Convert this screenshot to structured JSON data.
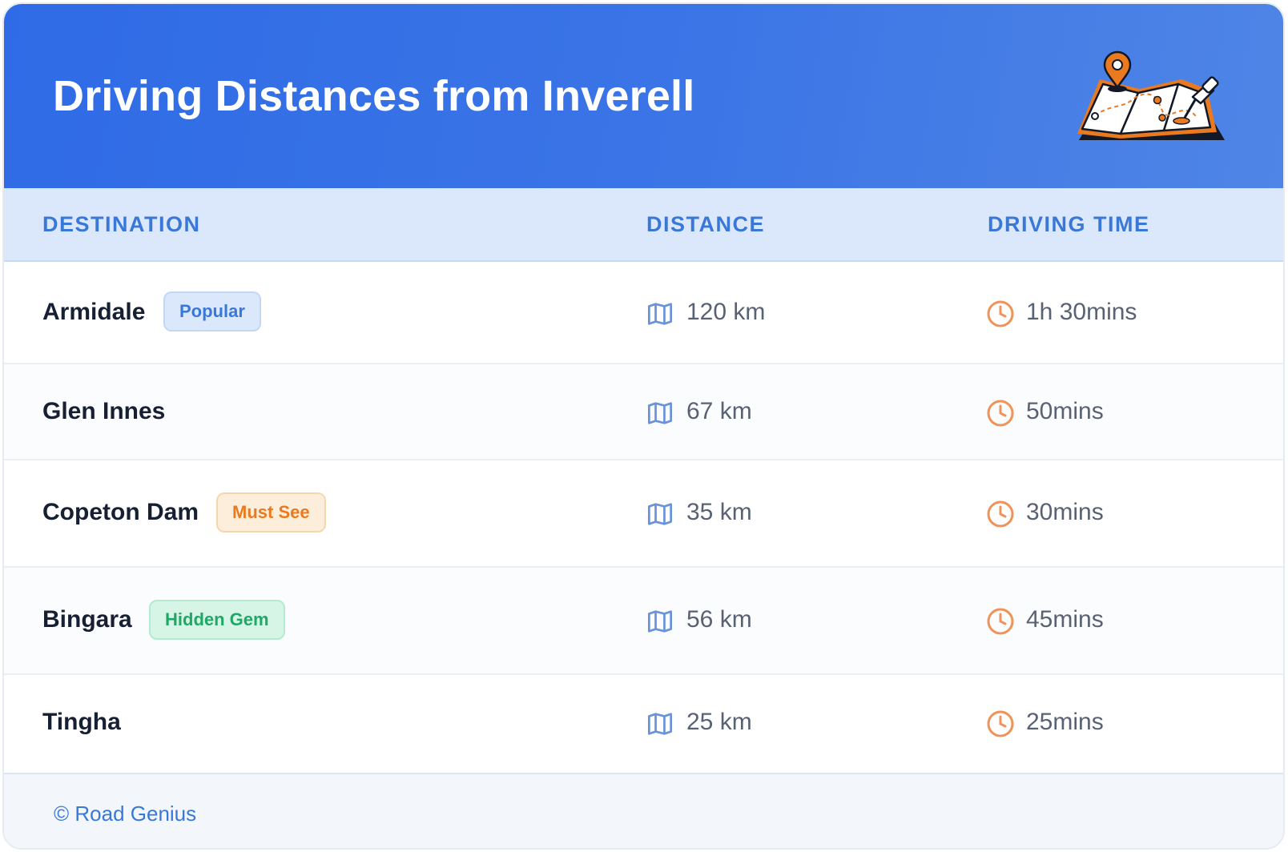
{
  "header": {
    "title": "Driving Distances from Inverell",
    "illustration_icon": "map-with-pins-icon"
  },
  "table": {
    "columns": [
      "DESTINATION",
      "DISTANCE",
      "DRIVING TIME"
    ],
    "rows": [
      {
        "destination": "Armidale",
        "badge": "Popular",
        "badge_color": "blue",
        "distance": "120 km",
        "time": "1h 30mins"
      },
      {
        "destination": "Glen Innes",
        "badge": null,
        "badge_color": null,
        "distance": "67 km",
        "time": "50mins"
      },
      {
        "destination": "Copeton Dam",
        "badge": "Must See",
        "badge_color": "orange",
        "distance": "35 km",
        "time": "30mins"
      },
      {
        "destination": "Bingara",
        "badge": "Hidden Gem",
        "badge_color": "green",
        "distance": "56 km",
        "time": "45mins"
      },
      {
        "destination": "Tingha",
        "badge": null,
        "badge_color": null,
        "distance": "25 km",
        "time": "25mins"
      }
    ],
    "distance_icon": "map-icon",
    "time_icon": "clock-icon"
  },
  "footer": {
    "copyright": "© Road Genius"
  },
  "colors": {
    "header_start": "#2f6be6",
    "header_end": "#4f85e6",
    "accent_blue": "#3a78d8",
    "accent_orange": "#ea7a1f",
    "accent_green": "#1fa866"
  }
}
